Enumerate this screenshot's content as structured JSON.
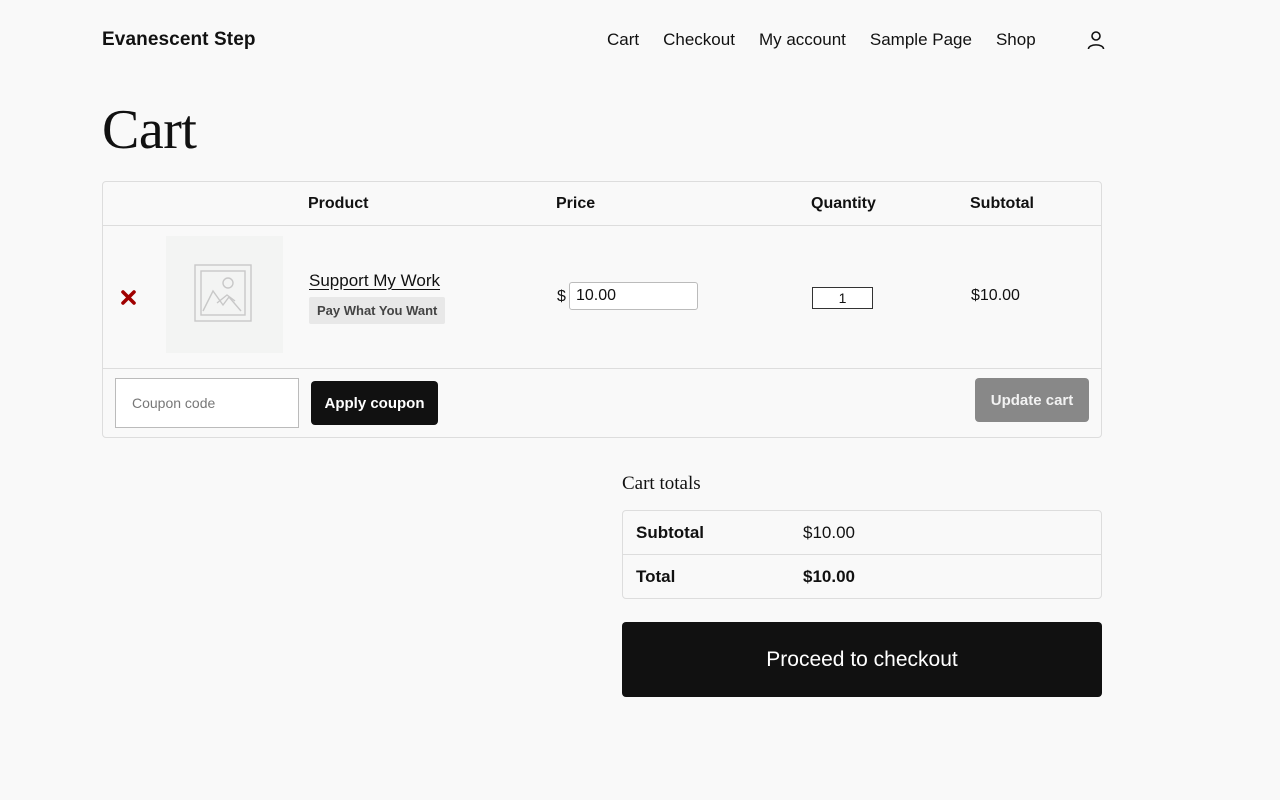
{
  "header": {
    "site_title": "Evanescent Step",
    "nav": [
      "Cart",
      "Checkout",
      "My account",
      "Sample Page",
      "Shop"
    ],
    "account_icon": "user-icon"
  },
  "page": {
    "title": "Cart"
  },
  "cart": {
    "columns": {
      "product": "Product",
      "price": "Price",
      "quantity": "Quantity",
      "subtotal": "Subtotal"
    },
    "items": [
      {
        "remove_icon": "close-x-icon",
        "thumbnail_icon": "image-placeholder-icon",
        "name": "Support My Work",
        "badge": "Pay What You Want",
        "currency_symbol": "$",
        "price_value": "10.00",
        "quantity": "1",
        "subtotal": "$10.00"
      }
    ],
    "coupon_placeholder": "Coupon code",
    "apply_coupon_label": "Apply coupon",
    "update_cart_label": "Update cart"
  },
  "totals": {
    "title": "Cart totals",
    "subtotal_label": "Subtotal",
    "subtotal_value": "$10.00",
    "total_label": "Total",
    "total_value": "$10.00",
    "checkout_label": "Proceed to checkout"
  },
  "colors": {
    "background": "#f9f9f9",
    "primary_button": "#111111",
    "disabled_button": "#888888",
    "remove_icon": "#a00000"
  }
}
